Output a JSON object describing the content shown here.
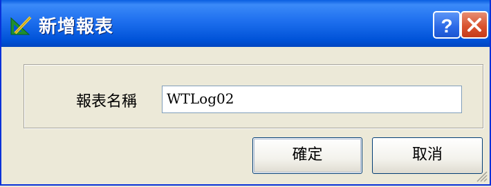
{
  "window": {
    "title": "新增報表",
    "icons": {
      "app": "report-edit-icon",
      "help": "help-icon",
      "close": "close-icon"
    },
    "colors": {
      "titlebar": "#0053d8",
      "close": "#d9532f",
      "face": "#ece9d8"
    }
  },
  "form": {
    "name_label": "報表名稱",
    "name_value": "WTLog02"
  },
  "buttons": {
    "ok_label": "確定",
    "cancel_label": "取消"
  }
}
